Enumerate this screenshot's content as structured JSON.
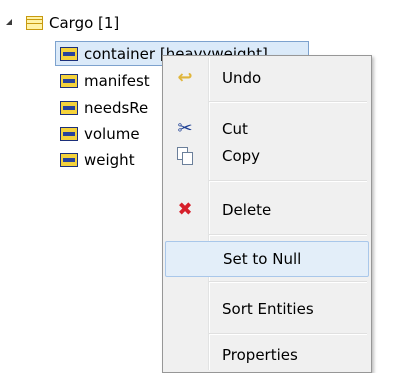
{
  "tree": {
    "root": {
      "label": "Cargo [1]",
      "icon": "entity-icon"
    },
    "children": [
      {
        "label": "container [heavyweight]",
        "icon": "attribute-icon",
        "selected": true
      },
      {
        "label": "manifest",
        "icon": "attribute-icon"
      },
      {
        "label": "needsRe",
        "icon": "attribute-icon"
      },
      {
        "label": "volume",
        "icon": "attribute-icon"
      },
      {
        "label": "weight",
        "icon": "attribute-icon"
      }
    ]
  },
  "context_menu": {
    "items": [
      {
        "label": "Undo",
        "icon": "undo-icon"
      },
      {
        "label": "Cut",
        "icon": "scissors-icon"
      },
      {
        "label": "Copy",
        "icon": "copy-icon"
      },
      {
        "label": "Delete",
        "icon": "delete-icon"
      },
      {
        "label": "Set to Null",
        "icon": "",
        "highlighted": true
      },
      {
        "label": "Sort Entities",
        "icon": ""
      },
      {
        "label": "Properties",
        "icon": ""
      }
    ]
  },
  "colors": {
    "selection_bg": "#dbeaf9",
    "selection_border": "#7da2ce",
    "menu_bg": "#f0f0f0",
    "menu_highlight": "#e3eef9",
    "delete_red": "#d6202b"
  }
}
